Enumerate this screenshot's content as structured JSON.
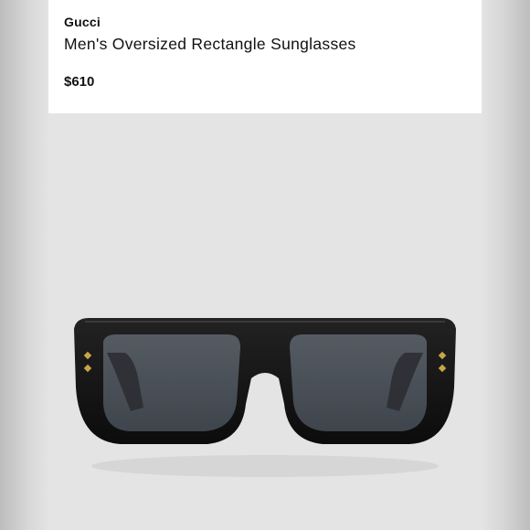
{
  "listing": {
    "brand": "Gucci",
    "title": "Men's Oversized Rectangle Sunglasses",
    "price": "$610"
  },
  "product_image": {
    "subject": "sunglasses-icon",
    "frame_color": "#111111",
    "lens_color": "#4b5158",
    "stud_color": "#c9a54a"
  }
}
